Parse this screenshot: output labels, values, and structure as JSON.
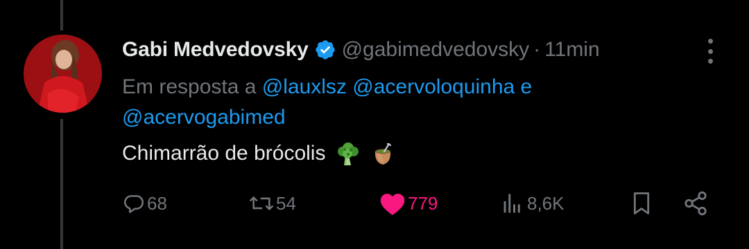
{
  "tweet": {
    "display_name": "Gabi Medvedovsky",
    "handle": "@gabimedvedovsky",
    "separator": "·",
    "time": "11min",
    "reply_prefix": "Em resposta a",
    "mentions": [
      "@lauxlsz",
      "@acervoloquinha",
      "e",
      "@acervogabimed"
    ],
    "text": "Chimarrão de brócolis"
  },
  "icons": {
    "verified": "verified-badge-icon",
    "more": "more-options-icon",
    "reply": "reply-icon",
    "retweet": "retweet-icon",
    "like": "heart-icon",
    "views": "views-icon",
    "bookmark": "bookmark-icon",
    "share": "share-icon"
  },
  "actions": {
    "replies": "68",
    "retweets": "54",
    "likes": "779",
    "views": "8,6K"
  },
  "colors": {
    "background": "#000000",
    "primary_text": "#e7e9ea",
    "secondary_text": "#71767b",
    "link": "#1d9bf0",
    "like": "#f91880",
    "verified": "#1d9bf0"
  }
}
